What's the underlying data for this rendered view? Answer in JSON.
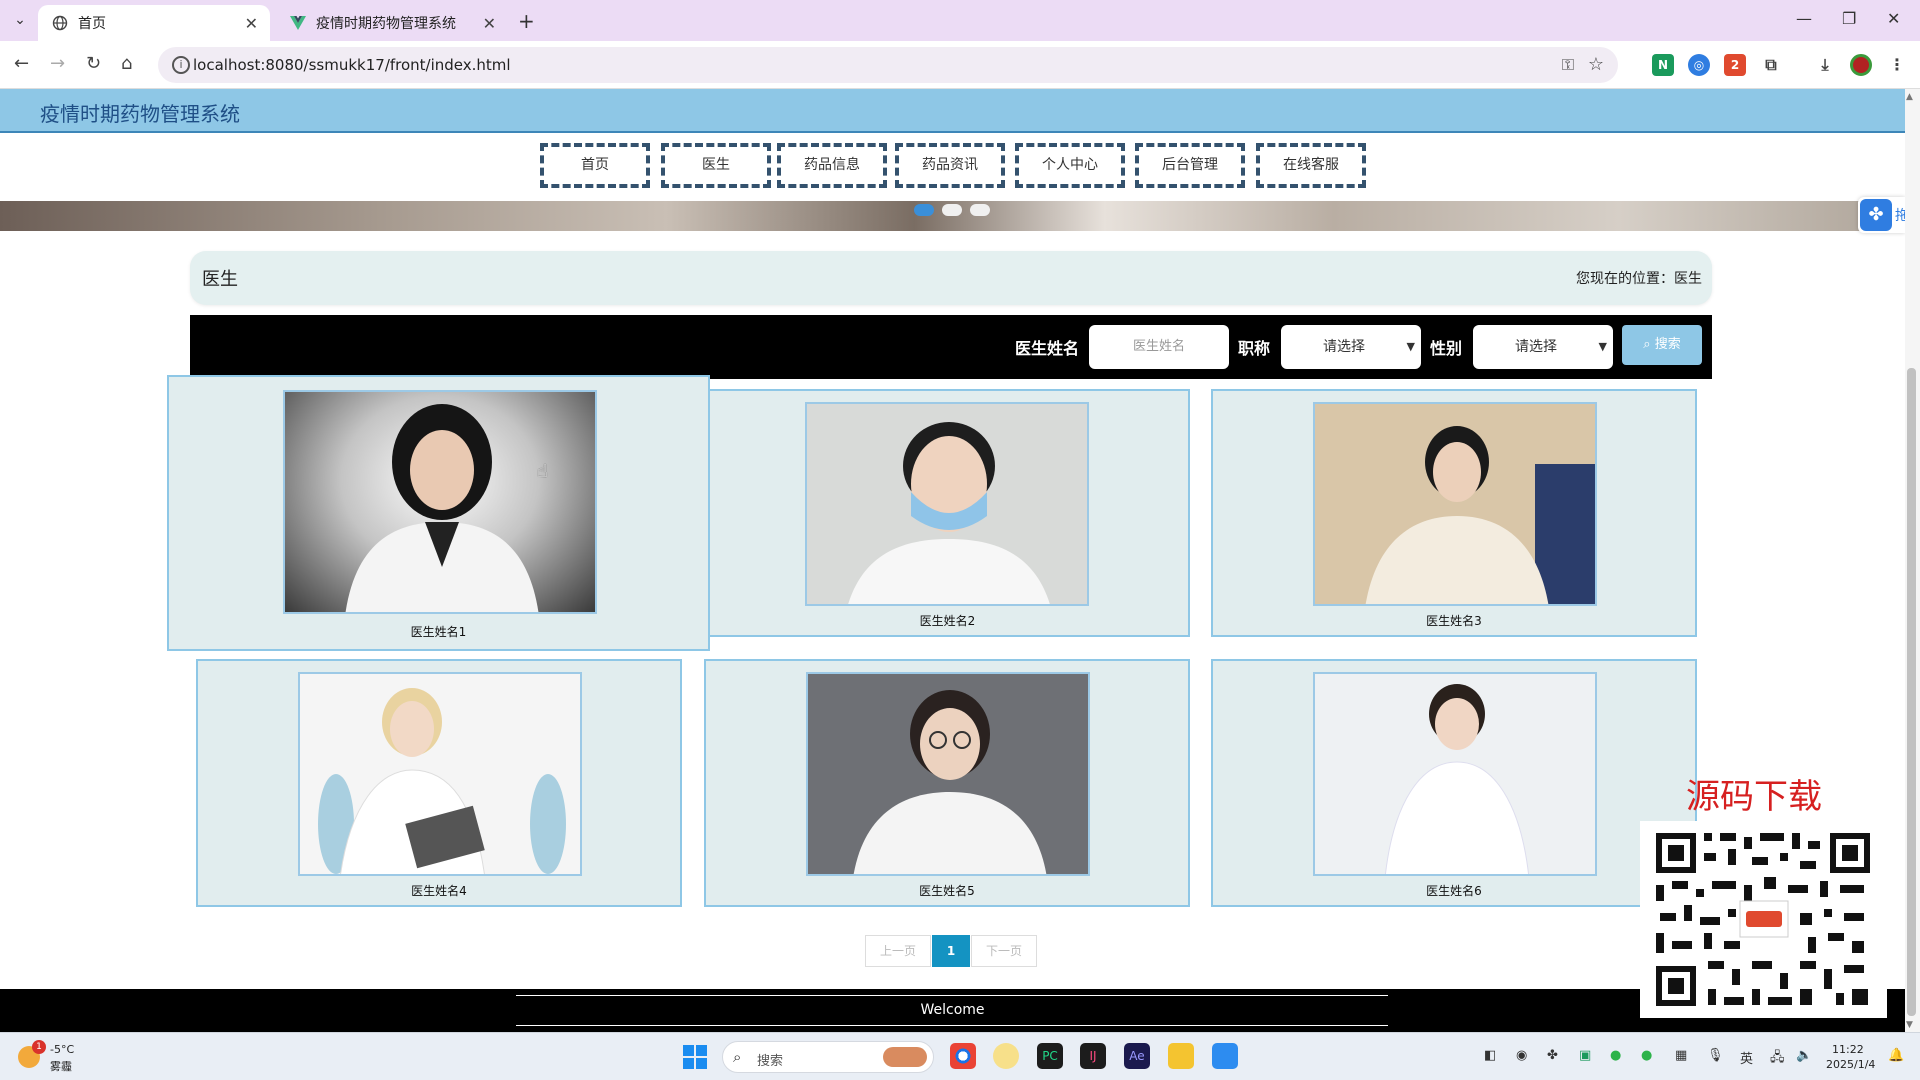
{
  "browser": {
    "tabs": [
      {
        "title": "首页",
        "active": true
      },
      {
        "title": "疫情时期药物管理系统",
        "active": false
      }
    ],
    "url": "localhost:8080/ssmukk17/front/index.html"
  },
  "site": {
    "title": "疫情时期药物管理系统",
    "nav": [
      "首页",
      "医生",
      "药品信息",
      "药品资讯",
      "个人中心",
      "后台管理",
      "在线客服"
    ],
    "float_label": "拖"
  },
  "breadcrumb": {
    "heading": "医生",
    "position": "您现在的位置：医生"
  },
  "search": {
    "name_label": "医生姓名",
    "name_placeholder": "医生姓名",
    "title_label": "职称",
    "title_select": "请选择",
    "gender_label": "性别",
    "gender_select": "请选择",
    "button": "搜索"
  },
  "doctors": [
    {
      "name": "医生姓名1"
    },
    {
      "name": "医生姓名2"
    },
    {
      "name": "医生姓名3"
    },
    {
      "name": "医生姓名4"
    },
    {
      "name": "医生姓名5"
    },
    {
      "name": "医生姓名6"
    }
  ],
  "pagination": {
    "prev": "上一页",
    "current": "1",
    "next": "下一页"
  },
  "footer": {
    "text": "Welcome"
  },
  "overlay": {
    "title": "源码下载"
  },
  "taskbar": {
    "weather_temp": "-5°C",
    "weather_desc": "雾霾",
    "weather_badge": "1",
    "search_placeholder": "搜索",
    "ime": "英",
    "time": "11:22",
    "date": "2025/1/4"
  },
  "colors": {
    "header": "#8ec7e6",
    "card_bg": "#e1edee",
    "page_active": "#1493c2",
    "overlay_title": "#d62020"
  }
}
